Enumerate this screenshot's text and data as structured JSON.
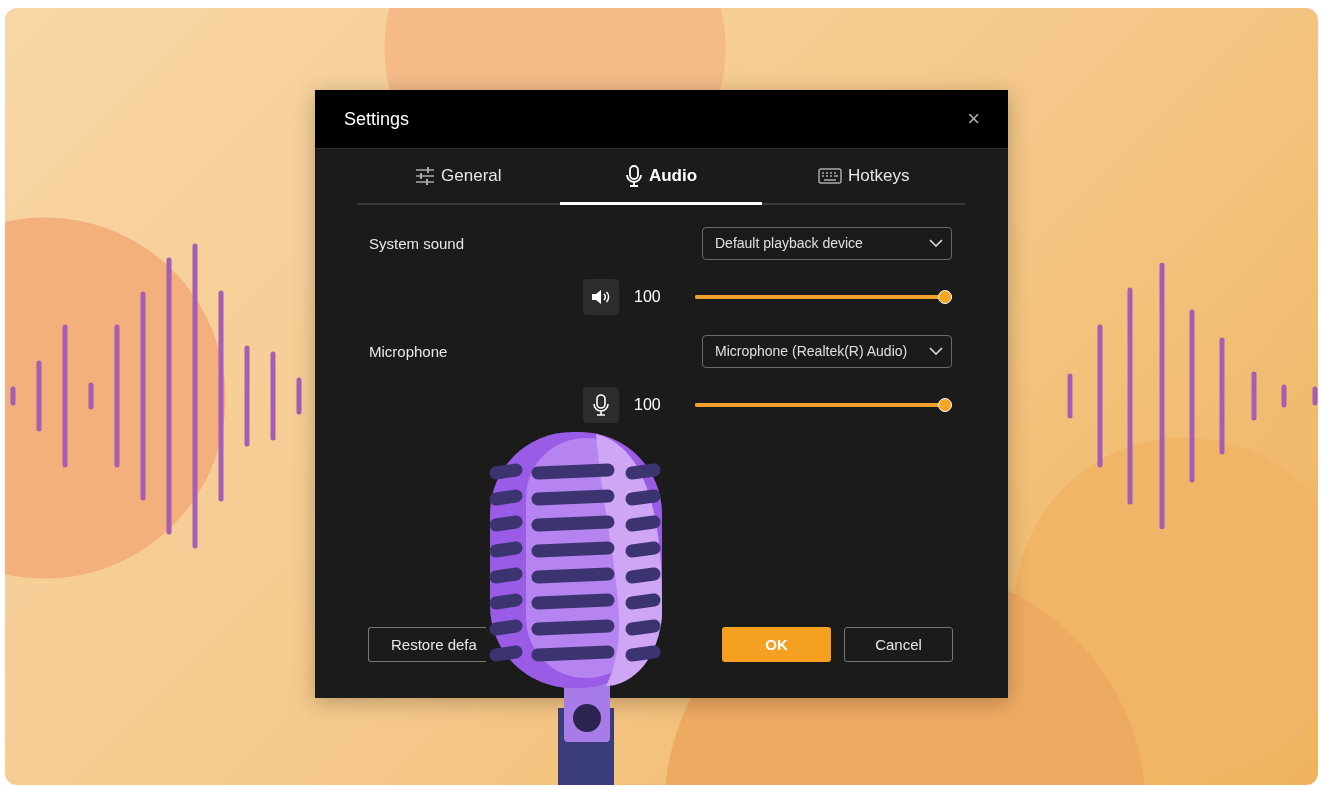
{
  "window": {
    "title": "Settings",
    "close": "×"
  },
  "tabs": [
    {
      "label": "General",
      "selected": false
    },
    {
      "label": "Audio",
      "selected": true
    },
    {
      "label": "Hotkeys",
      "selected": false
    }
  ],
  "sections": [
    {
      "kind": "speaker",
      "label": "System sound",
      "device": "Default playback device",
      "reading": "100",
      "level": 1.0
    },
    {
      "kind": "microphone",
      "label": "Microphone",
      "device": "Microphone (Realtek(R) Audio)",
      "reading": "100",
      "level": 1.0
    }
  ],
  "buttons": [
    {
      "label": "Restore defa",
      "kind": "secondary"
    },
    {
      "label": "OK",
      "kind": "primary"
    },
    {
      "label": "Cancel",
      "kind": "secondary"
    }
  ]
}
